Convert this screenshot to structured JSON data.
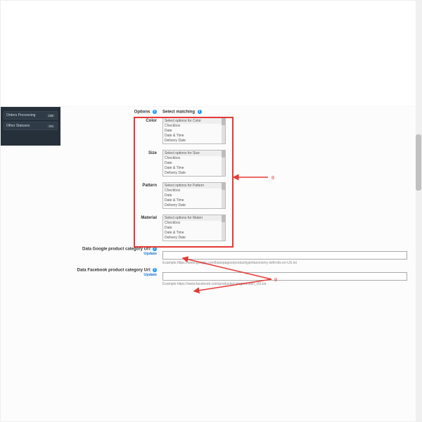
{
  "sidebar": {
    "rows": [
      {
        "label": "Orders Processing",
        "count": "196"
      },
      {
        "label": "Other Statuses",
        "count": "0%"
      }
    ]
  },
  "headers": {
    "options": "Options",
    "select": "Select matching"
  },
  "option_rows": [
    {
      "label": "Color",
      "head": "Select options for Color",
      "items": [
        "Checkbox",
        "Date",
        "Date & Time",
        "Delivery Date"
      ]
    },
    {
      "label": "Size",
      "head": "Select options for Size",
      "items": [
        "Checkbox",
        "Date",
        "Date & Time",
        "Delivery Date"
      ]
    },
    {
      "label": "Pattern",
      "head": "Select options for Pattern",
      "items": [
        "Checkbox",
        "Date",
        "Date & Time",
        "Delivery Date"
      ]
    },
    {
      "label": "Material",
      "head": "Select options for Materi",
      "items": [
        "Checkbox",
        "Date",
        "Date & Time",
        "Delivery Date"
      ]
    }
  ],
  "url_blocks": [
    {
      "label": "Data Google product category Url:",
      "link": "Update",
      "example": "Example:https://www.google.com/basepages/producttype/taxonomy-with-ids.en-US.txt"
    },
    {
      "label": "Data Facebook product category Url:",
      "link": "Update",
      "example": "Example:https://www.facebook.com/products/categories/en_US.txt"
    }
  ],
  "annotations": {
    "n8": "8",
    "n9": "9"
  }
}
